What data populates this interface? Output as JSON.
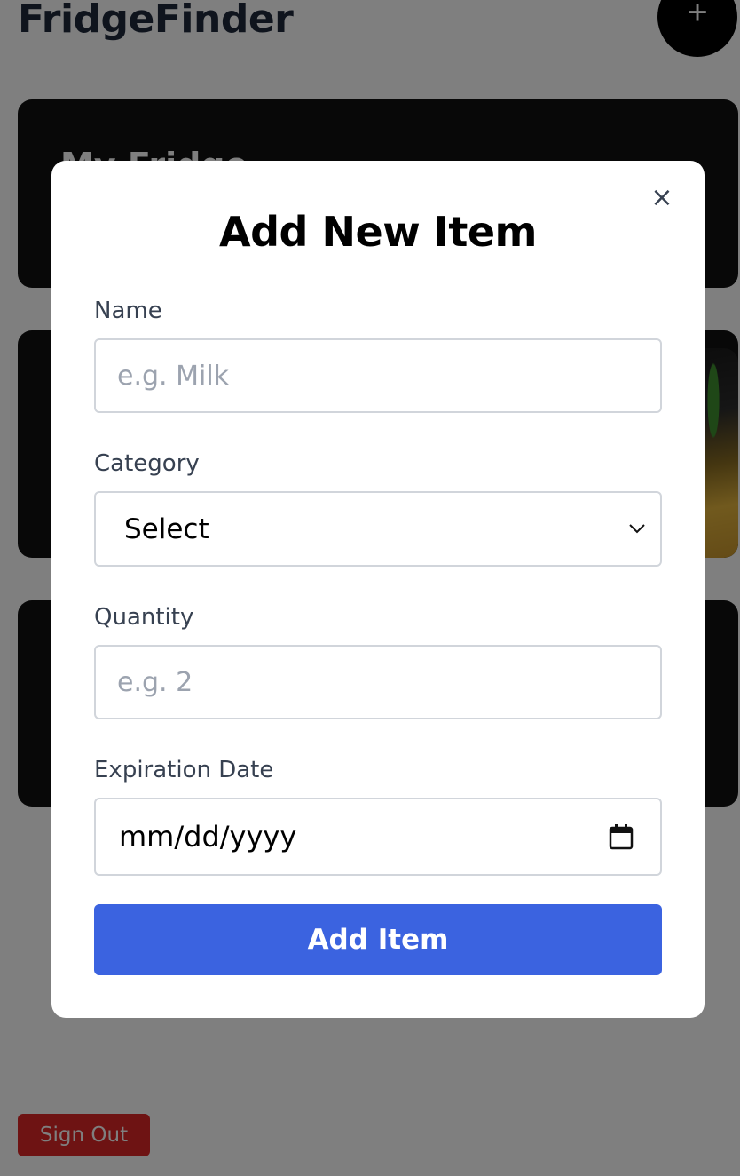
{
  "app": {
    "title": "FridgeFinder",
    "add_button_label": "+",
    "sign_out_label": "Sign Out"
  },
  "cards": [
    {
      "title": "My Fridge"
    }
  ],
  "modal": {
    "title": "Add New Item",
    "close_label": "×",
    "fields": {
      "name": {
        "label": "Name",
        "placeholder": "e.g. Milk",
        "value": ""
      },
      "category": {
        "label": "Category",
        "selected": "Select"
      },
      "quantity": {
        "label": "Quantity",
        "placeholder": "e.g. 2",
        "value": ""
      },
      "expiration": {
        "label": "Expiration Date",
        "display": "mm/dd/yyyy"
      }
    },
    "submit_label": "Add Item"
  },
  "colors": {
    "primary_button": "#3b63e0",
    "sign_out": "#dc2626",
    "card_background": "#111111"
  }
}
